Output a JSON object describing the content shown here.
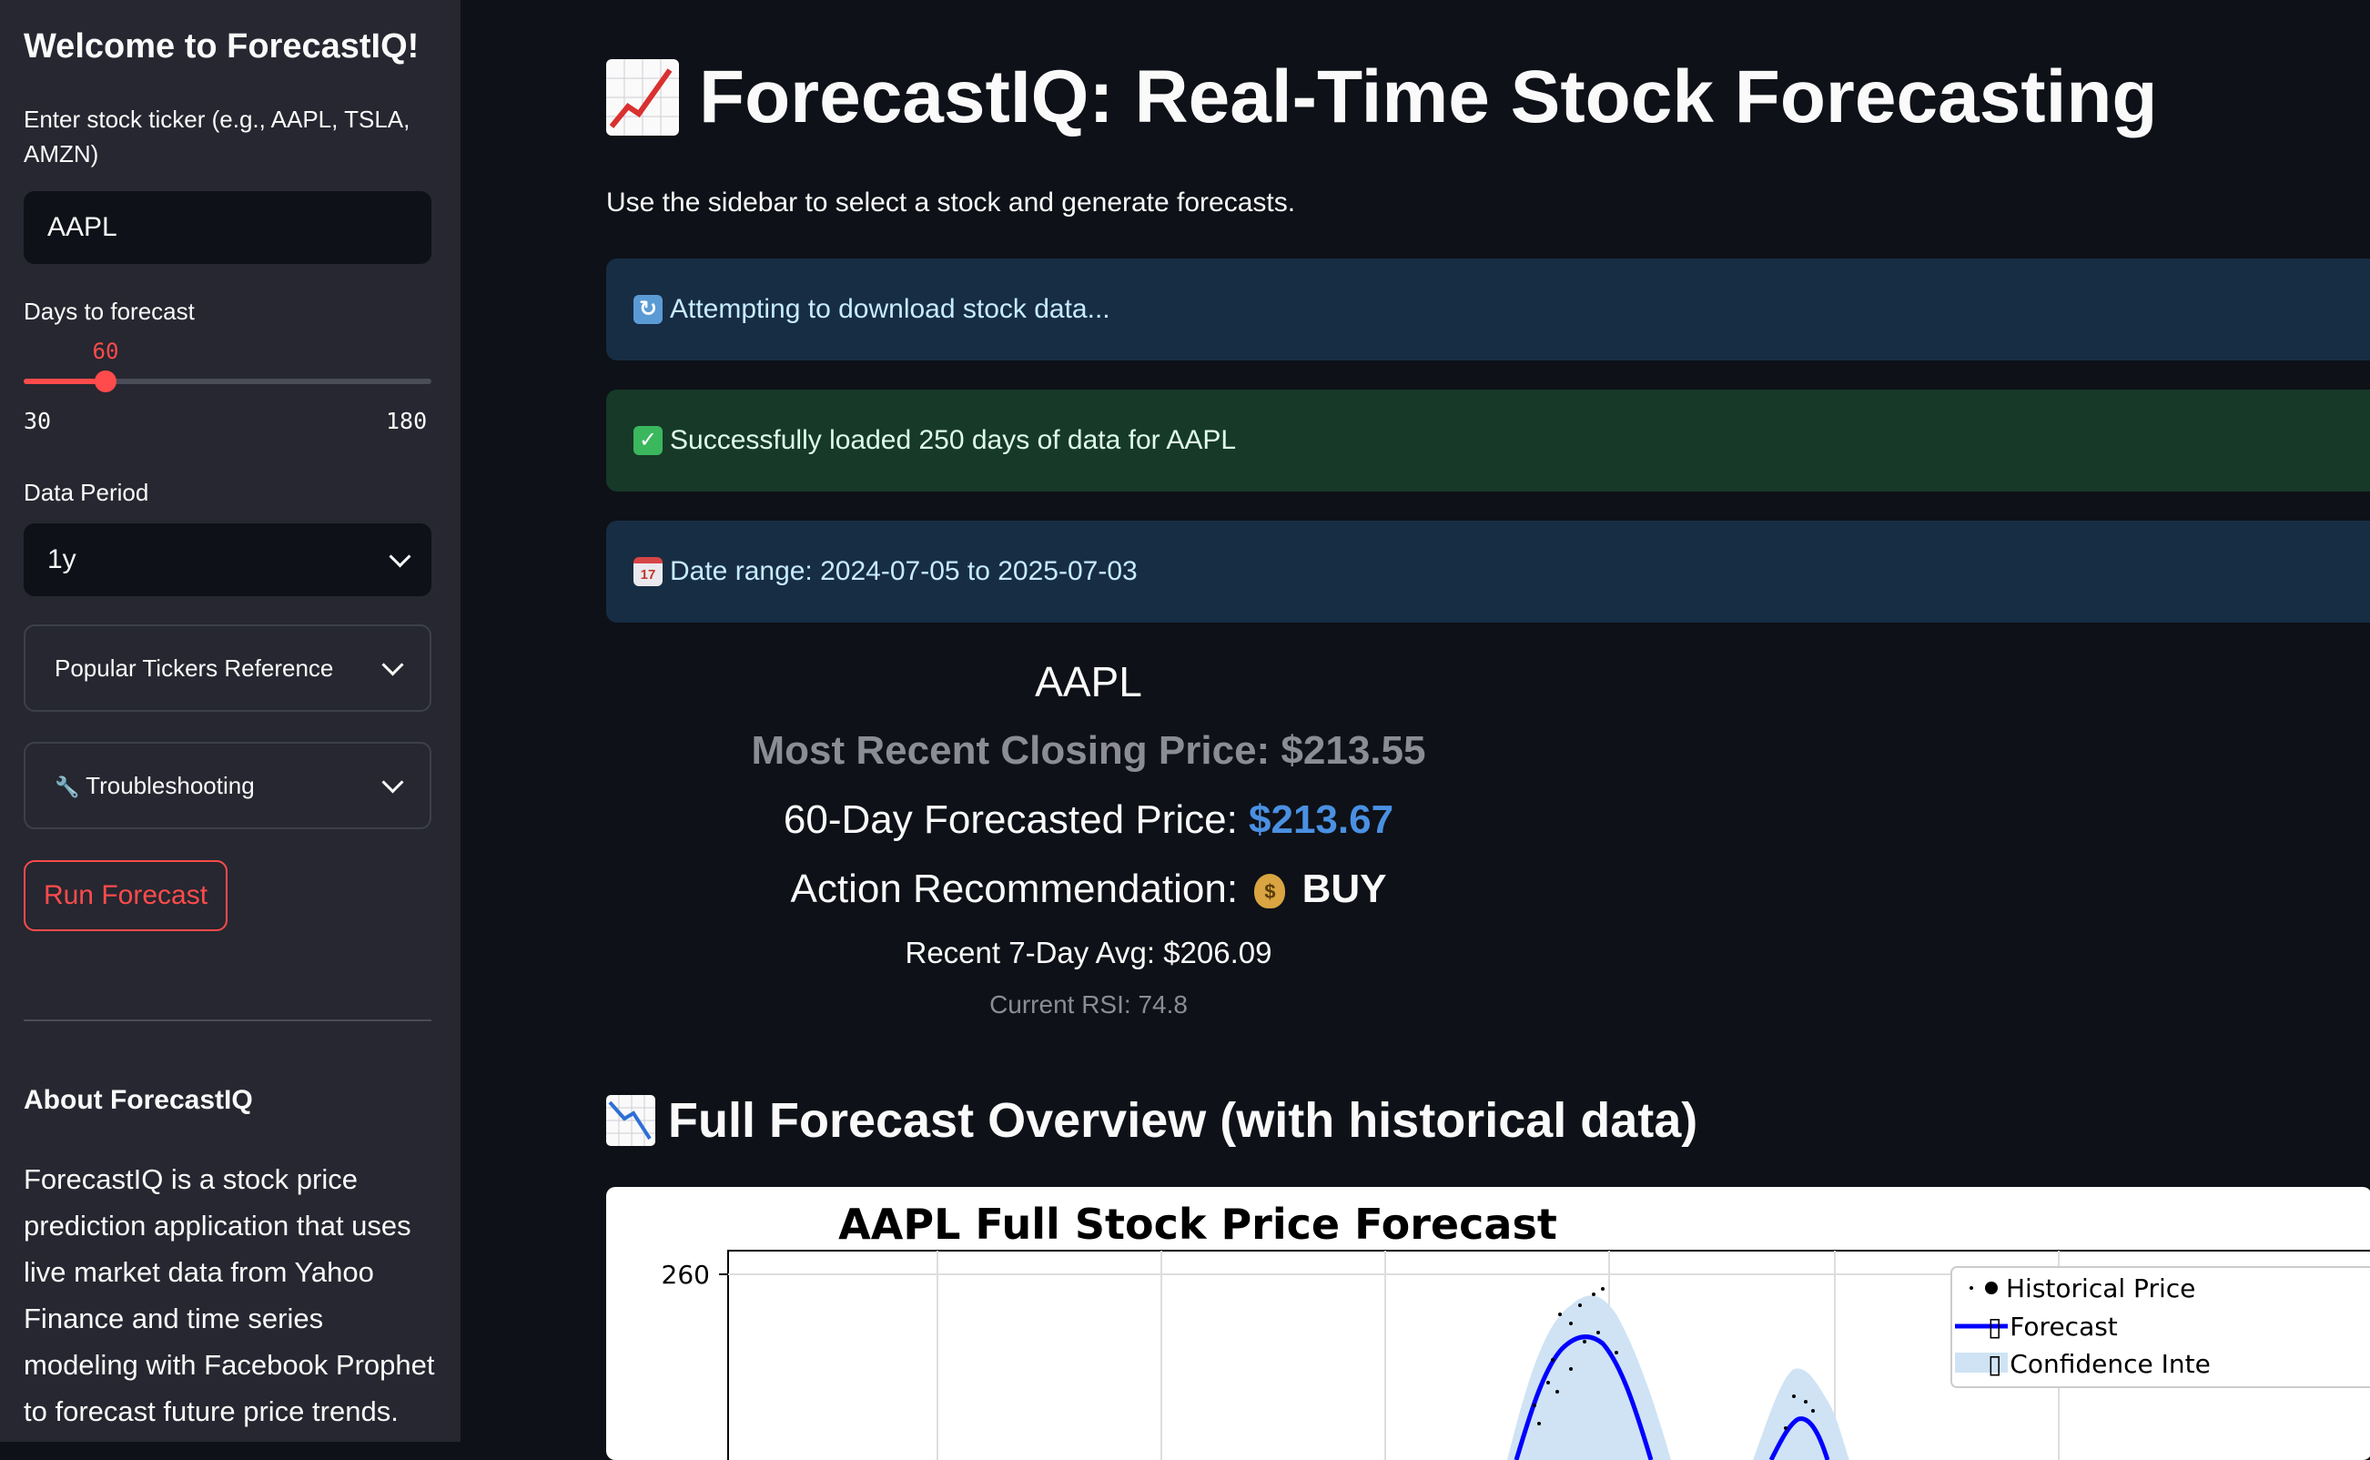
{
  "sidebar": {
    "welcome": "Welcome to ForecastIQ!",
    "ticker_label": "Enter stock ticker (e.g., AAPL, TSLA, AMZN)",
    "ticker_value": "AAPL",
    "days_label": "Days to forecast",
    "days_value": "60",
    "days_fraction": 0.2,
    "days_min": "30",
    "days_max": "180",
    "period_label": "Data Period",
    "period_value": "1y",
    "expander_popular": "Popular Tickers Reference",
    "expander_troubleshooting": "Troubleshooting",
    "wrench_emoji": "🔧",
    "run_button": "Run Forecast",
    "about_title": "About ForecastIQ",
    "about_text": "ForecastIQ is a stock price prediction application that uses live market data from Yahoo Finance and time series modeling with Facebook Prophet to forecast future price trends."
  },
  "main": {
    "title": "ForecastIQ: Real-Time Stock Forecasting",
    "subtitle": "Use the sidebar to select a stock and generate forecasts.",
    "alert_download": "Attempting to download stock data...",
    "alert_success": "Successfully loaded 250 days of data for AAPL",
    "alert_daterange": "Date range: 2024-07-05 to 2025-07-03",
    "ticker": "AAPL",
    "recent_close": "Most Recent Closing Price: $213.55",
    "forecast_label": "60-Day Forecasted Price: ",
    "forecast_value": "$213.67",
    "action_label": "Action Recommendation:",
    "action_value": "BUY",
    "bag_symbol": "$",
    "avg_7day": "Recent 7-Day Avg: $206.09",
    "rsi": "Current RSI: 74.8",
    "section_title": "Full Forecast Overview (with historical data)"
  },
  "chart_data": {
    "type": "line",
    "title": "AAPL Full Stock Price Forecast",
    "y_ticks": [
      "260"
    ],
    "legend": [
      "Historical Price",
      "▯ Forecast",
      "▯ Confidence Inte"
    ],
    "legend_position": "top-right",
    "grid": true,
    "colors": {
      "forecast": "#0000ff",
      "confidence": "#cfe3f5",
      "historical": "#000000"
    }
  },
  "colors": {
    "accent": "#ff4b4b",
    "forecast_value": "#4a90e2",
    "info_bg": "#172d43",
    "success_bg": "#173928"
  }
}
